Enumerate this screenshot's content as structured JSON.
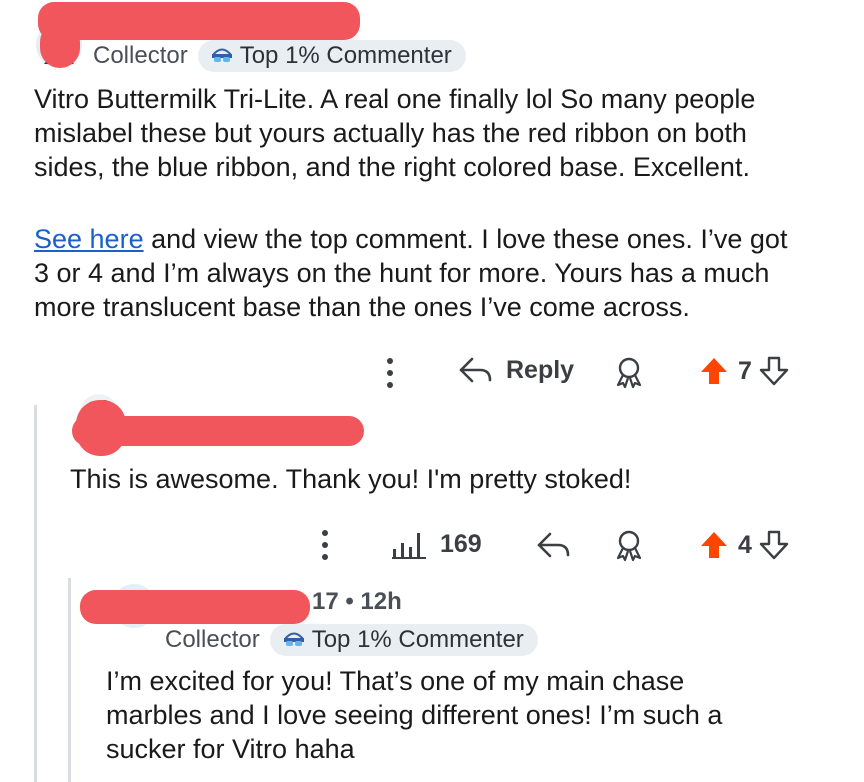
{
  "comment1": {
    "flair_user": "Collector",
    "flair_badge": "Top 1% Commenter",
    "body_line1": "Vitro Buttermilk Tri-Lite. A real one finally lol So many people",
    "body_line2": "mislabel these but yours actually has the red ribbon on both",
    "body_line3": "sides, the blue ribbon, and the right colored base. Excellent.",
    "link_text": "See here",
    "body2_line1_rest": " and view the top comment. I love these ones. I’ve got",
    "body2_line2": "3 or 4 and I’m always on the hunt for more. Yours has a much",
    "body2_line3": "more translucent base than the ones I’ve come across.",
    "reply_label": "Reply",
    "vote_count": "7"
  },
  "comment2": {
    "body": "This is awesome. Thank you! I'm pretty stoked!",
    "views": "169",
    "vote_count": "4"
  },
  "comment3": {
    "time_suffix": "17 • 12h",
    "flair_user": "Collector",
    "flair_badge": "Top 1% Commenter",
    "body_line1": "I’m excited for you! That’s one of my main chase",
    "body_line2": "marbles and I love seeing different ones! I’m such a",
    "body_line3": "sucker for Vitro haha"
  },
  "colors": {
    "upvote": "#ff4500",
    "link": "#1a5fcc",
    "redaction": "#f0565b"
  }
}
